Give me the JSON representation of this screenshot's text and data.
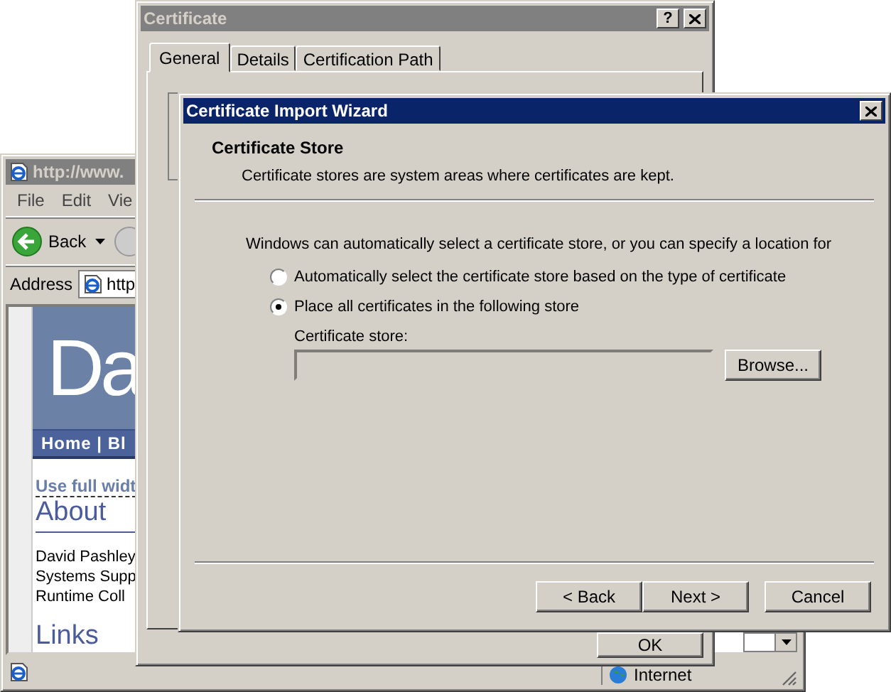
{
  "browser_window": {
    "title": "http://www.",
    "menu": [
      "File",
      "Edit",
      "Vie"
    ],
    "back_label": "Back",
    "address_label": "Address",
    "address": "http",
    "banner": "Da",
    "nav": "Home | Bl",
    "link": "Use full widt",
    "about_heading": "About",
    "about_lines": [
      "David Pashley",
      "Systems Supp",
      "Runtime Coll"
    ],
    "links_heading": "Links",
    "status": "Internet"
  },
  "certificate_window": {
    "title": "Certificate",
    "help": "?",
    "tabs": [
      {
        "label": "General",
        "selected": true
      },
      {
        "label": "Details",
        "selected": false
      },
      {
        "label": "Certification Path",
        "selected": false
      }
    ],
    "ok": "OK"
  },
  "wizard": {
    "title": "Certificate Import Wizard",
    "heading": "Certificate Store",
    "description": "Certificate stores are system areas where certificates are kept.",
    "intro": "Windows can automatically select a certificate store, or you can specify a location for",
    "options": [
      {
        "label": "Automatically select the certificate store based on the type of certificate",
        "selected": false
      },
      {
        "label": "Place all certificates in the following store",
        "selected": true
      }
    ],
    "store_label": "Certificate store:",
    "store_disabled": true,
    "browse": "Browse...",
    "buttons": [
      {
        "label": "< Back",
        "kind": "nav"
      },
      {
        "label": "Next >",
        "kind": "nav"
      },
      {
        "label": "Cancel",
        "kind": "cancel"
      }
    ]
  }
}
